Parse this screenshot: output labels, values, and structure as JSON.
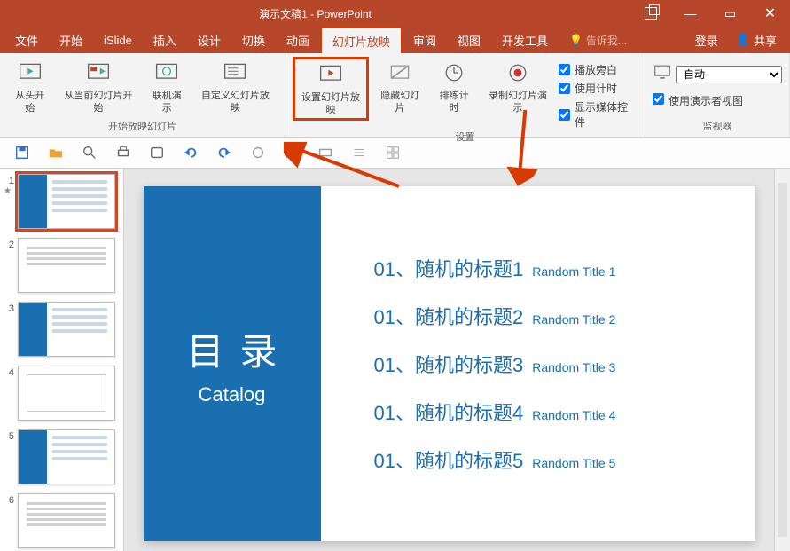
{
  "title": "演示文稿1 - PowerPoint",
  "menu": {
    "file": "文件",
    "home": "开始",
    "islide": "iSlide",
    "insert": "插入",
    "design": "设计",
    "transition": "切换",
    "animation": "动画",
    "slideshow": "幻灯片放映",
    "review": "审阅",
    "view": "视图",
    "develop": "开发工具",
    "tellme": "告诉我...",
    "login": "登录",
    "share": "共享"
  },
  "ribbon": {
    "from_start": "从头开始",
    "from_current": "从当前幻灯片开始",
    "present_online": "联机演示",
    "custom_show": "自定义幻灯片放映",
    "group_start": "开始放映幻灯片",
    "setup_show": "设置幻灯片放映",
    "hide_slide": "隐藏幻灯片",
    "rehearse": "排练计时",
    "record": "录制幻灯片演示",
    "play_narration": "播放旁白",
    "use_timings": "使用计时",
    "show_media": "显示媒体控件",
    "group_setup": "设置",
    "monitor_auto": "自动",
    "use_presenter": "使用演示者视图",
    "group_monitor": "监视器"
  },
  "slide": {
    "mulu": "目录",
    "catalog": "Catalog",
    "items": [
      {
        "zh": "01、随机的标题1",
        "en": "Random Title 1"
      },
      {
        "zh": "01、随机的标题2",
        "en": "Random Title 2"
      },
      {
        "zh": "01、随机的标题3",
        "en": "Random Title 3"
      },
      {
        "zh": "01、随机的标题4",
        "en": "Random Title 4"
      },
      {
        "zh": "01、随机的标题5",
        "en": "Random Title 5"
      }
    ]
  },
  "thumbs": [
    "1",
    "2",
    "3",
    "4",
    "5",
    "6"
  ],
  "colors": {
    "accent": "#b7472a",
    "highlight": "#d83b01",
    "slide_blue": "#1a6fb0"
  }
}
